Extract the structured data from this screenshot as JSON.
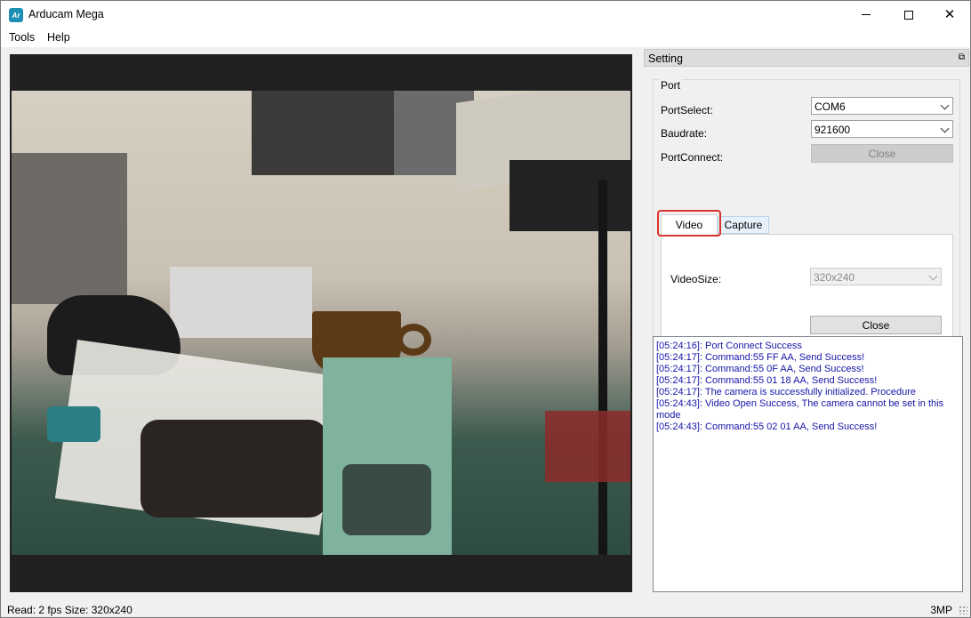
{
  "window": {
    "title": "Arducam Mega",
    "app_icon_text": "Ar"
  },
  "menu": {
    "items": [
      "Tools",
      "Help"
    ]
  },
  "setting": {
    "title": "Setting",
    "port_group": {
      "title": "Port",
      "port_select_label": "PortSelect:",
      "port_select_value": "COM6",
      "baudrate_label": "Baudrate:",
      "baudrate_value": "921600",
      "port_connect_label": "PortConnect:",
      "port_connect_button": "Close"
    },
    "tabs": [
      {
        "label": "Video",
        "active": true
      },
      {
        "label": "Capture",
        "active": false
      }
    ],
    "video_tab": {
      "video_size_label": "VideoSize:",
      "video_size_value": "320x240",
      "close_button": "Close"
    }
  },
  "log": {
    "lines": [
      "[05:24:16]: Port Connect Success",
      "[05:24:17]: Command:55 FF AA, Send Success!",
      "[05:24:17]: Command:55 0F AA, Send Success!",
      "[05:24:17]: Command:55 01 18 AA, Send Success!",
      "[05:24:17]: The camera is successfully initialized. Procedure",
      "[05:24:43]: Video Open Success, The camera cannot be set in this mode",
      "[05:24:43]: Command:55 02 01 AA, Send Success!"
    ]
  },
  "status": {
    "left": "Read: 2 fps Size: 320x240",
    "right": "3MP"
  },
  "colors": {
    "log_text": "#1515a8",
    "highlight": "#d9342b",
    "app_icon": "#1e8fb4"
  }
}
